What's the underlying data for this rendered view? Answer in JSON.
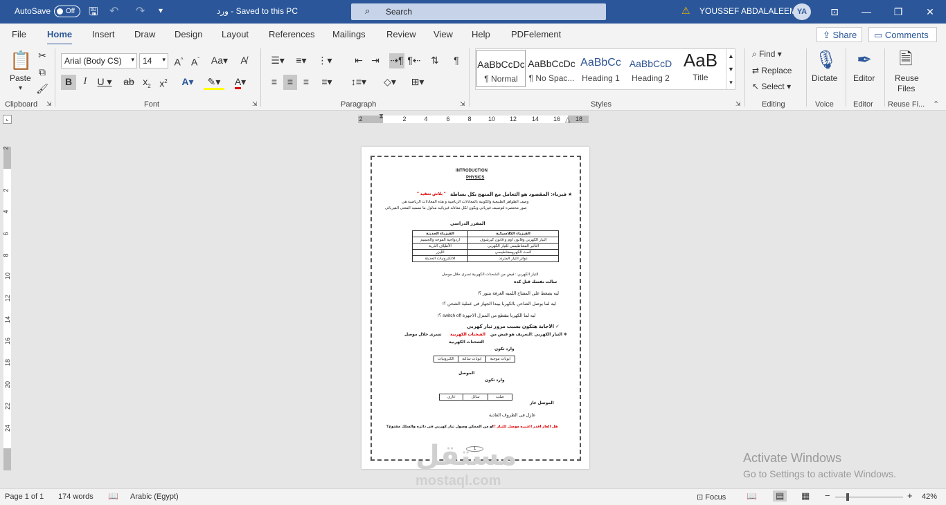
{
  "titlebar": {
    "autosave": "AutoSave",
    "toggle": "Off",
    "doc_title": "ورد  -  Saved to this PC",
    "search_placeholder": "Search",
    "user": "YOUSSEF ABDALALEEM",
    "initials": "YA"
  },
  "menu": {
    "tabs": [
      "File",
      "Home",
      "Insert",
      "Draw",
      "Design",
      "Layout",
      "References",
      "Mailings",
      "Review",
      "View",
      "Help",
      "PDFelement"
    ],
    "share": "Share",
    "comments": "Comments"
  },
  "ribbon": {
    "clipboard": {
      "label": "Clipboard",
      "paste": "Paste"
    },
    "font": {
      "label": "Font",
      "family": "Arial (Body CS)",
      "size": "14"
    },
    "paragraph": {
      "label": "Paragraph"
    },
    "styles": {
      "label": "Styles",
      "items": [
        {
          "preview": "AaBbCcDc",
          "name": "¶ Normal"
        },
        {
          "preview": "AaBbCcDc",
          "name": "¶ No Spac..."
        },
        {
          "preview": "AaBbCc",
          "name": "Heading 1"
        },
        {
          "preview": "AaBbCcD",
          "name": "Heading 2"
        },
        {
          "preview": "AaB",
          "name": "Title"
        }
      ]
    },
    "editing": {
      "label": "Editing",
      "find": "Find",
      "replace": "Replace",
      "select": "Select"
    },
    "voice": {
      "label": "Voice",
      "dictate": "Dictate"
    },
    "editor": {
      "label": "Editor",
      "btn": "Editor"
    },
    "reuse": {
      "label": "Reuse Fi...",
      "btn1": "Reuse",
      "btn2": "Files"
    }
  },
  "ruler": {
    "h": [
      "2",
      "2",
      "4",
      "6",
      "8",
      "10",
      "12",
      "14",
      "16",
      "18"
    ],
    "v": [
      "2",
      "2",
      "4",
      "6",
      "8",
      "10",
      "12",
      "14",
      "16",
      "18",
      "20",
      "22",
      "24"
    ]
  },
  "document": {
    "heading1": "INTRODUCTION",
    "heading2": "PHYSICS",
    "line1": "★ فيزياء: المقصود هو التعامل مع المنهج بكل بساطة",
    "line1_red": "\" بلاش تعقيد \"",
    "line2": "وصف الظواهر الطبيعية والكونية بالمعادلات الرياضية و هذه المعادلات الرياضية هي",
    "line3": "صور مختصره لتوصيف فيزيائي ويكون لكل معادله فيزيائيه مدلول ما نسميه المعنى الفيزيائي",
    "syllabus": "المقرر الدراسي",
    "table": [
      [
        "الفيزياء الكلاسيكية",
        "الفيزياء الحديثة"
      ],
      [
        "التيار الكهربي وقانون اوم و قانون كيرشوف",
        "ازدواجية الموجه والجسيم"
      ],
      [
        "التأثير المغناطيسي للتيار الكهربي",
        "الأطياف الذرية"
      ],
      [
        "الحث الكهرومغناطيسي",
        "الليزر"
      ],
      [
        "دوائر التيار المتردد",
        "الالكترونيات الحديثة"
      ]
    ],
    "b1": "التيار الكهربي : فيض من الشحنات الكهربية تسرى خلال موصل",
    "b2": "سالت نفسك قبل كده",
    "q1": "ليه بضغط على المفتاح  اللمبه الغرفة بتنور ؟!",
    "q2": "ليه لما بوصل الشاحن بالكهربا بيبدا الجهاز فى عملية الشحن ؟!",
    "q3": "ليه لما الكهربا بتقطع من المنزل  الاجهزة  switch off ؟!",
    "a1": "✓ الاجابة هتكون بسبب مرور تيار كهربي",
    "a2": "❖ التيار الكهربي :التعريف هو فيض من",
    "a2_red": "الشحنات الكهربية",
    "a2_end": "تسرى   خلال موصل",
    "charges": "الشحنات الكهربية",
    "types": "وارد تكون",
    "t2": [
      "ايونات موجبة",
      "ايونات سالبة",
      "الكترونيات"
    ],
    "conductor": "الموصل",
    "types2": "وارد تكون",
    "t3": [
      "صلب",
      "سائل",
      "غازي"
    ],
    "gas": "الموصل غاز",
    "insulator": "عازل فى الظروف العادية",
    "last_red": "هل الغاز اقدر اعتبره موصل للتيار !!",
    "last": "او من الممكن وصول تيار كهربي فى دائره والسلك مفتوح؟",
    "pagenum": "1"
  },
  "watermark": {
    "line1": "Activate Windows",
    "line2": "Go to Settings to activate Windows.",
    "brand": "مستقل",
    "brand2": "mostaql.com"
  },
  "status": {
    "page": "Page 1 of 1",
    "words": "174 words",
    "lang": "Arabic (Egypt)",
    "focus": "Focus",
    "zoom": "42%"
  }
}
